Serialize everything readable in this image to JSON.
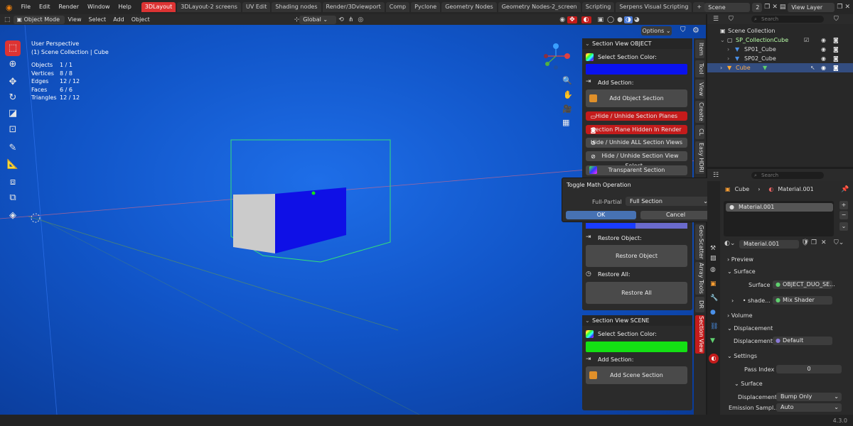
{
  "menubar": {
    "items": [
      "File",
      "Edit",
      "Render",
      "Window",
      "Help"
    ],
    "workspaces": [
      "3DLayout",
      "3DLayout-2 screens",
      "UV Edit",
      "Shading nodes",
      "Render/3Dviewport",
      "Comp",
      "Pyclone",
      "Geometry Nodes",
      "Geometry Nodes-2_screen",
      "Scripting",
      "Serpens Visual Scripting"
    ],
    "active_workspace": "3DLayout",
    "add_tab": "+",
    "scene": "Scene",
    "scene_users": "2",
    "view_layer": "View Layer"
  },
  "viewport_header": {
    "mode": "Object Mode",
    "menus": [
      "View",
      "Select",
      "Add",
      "Object"
    ],
    "orientation": "Global",
    "options": "Options"
  },
  "viewport": {
    "perspective": "User Perspective",
    "collection": "(1) Scene Collection | Cube",
    "stats": [
      {
        "label": "Objects",
        "value": "1 / 1"
      },
      {
        "label": "Vertices",
        "value": "8 / 8"
      },
      {
        "label": "Edges",
        "value": "12 / 12"
      },
      {
        "label": "Faces",
        "value": "6 / 6"
      },
      {
        "label": "Triangles",
        "value": "12 / 12"
      }
    ]
  },
  "section_object": {
    "title": "Section View OBJECT",
    "select_color": "Select Section Color:",
    "color": "#0a12ee",
    "add_section": "Add Section:",
    "add_object_section": "Add Object Section",
    "hide_planes": "Hide / Unhide Section Planes",
    "plane_hidden": "Section Plane Hidden In Render",
    "hide_all": "Hide / Unhide ALL Section Views",
    "hide_selected": "Hide / Unhide Section View Select...",
    "transparent": "Transparent Section",
    "restore_object_label": "Restore Object:",
    "restore_object": "Restore Object",
    "restore_all_label": "Restore All:",
    "restore_all": "Restore All"
  },
  "section_scene": {
    "title": "Section View SCENE",
    "select_color": "Select Section Color:",
    "color": "#14e014",
    "add_section": "Add Section:",
    "add_scene_section": "Add Scene Section"
  },
  "side_tabs": [
    "Item",
    "Tool",
    "View",
    "Create",
    "CL",
    "Easy HDRI",
    "Geo-Scatter",
    "Array Tools",
    "DR",
    "Section View"
  ],
  "popup": {
    "title": "Toggle Math Operation",
    "field_label": "Full-Partial",
    "field_value": "Full Section",
    "ok": "OK",
    "cancel": "Cancel"
  },
  "outliner": {
    "search_placeholder": "Search",
    "rows": [
      {
        "label": "Scene Collection"
      },
      {
        "label": "SP_CollectionCube"
      },
      {
        "label": "SP01_Cube"
      },
      {
        "label": "SP02_Cube"
      },
      {
        "label": "Cube"
      }
    ]
  },
  "properties": {
    "search_placeholder": "Search",
    "breadcrumb_object": "Cube",
    "breadcrumb_material": "Material.001",
    "slot": "Material.001",
    "material_name": "Material.001",
    "preview": "Preview",
    "surface_section": "Surface",
    "surface_label": "Surface",
    "surface_value": "OBJECT_DUO_SE...",
    "shader_label": "shade...",
    "shader_value": "Mix Shader",
    "volume": "Volume",
    "displacement_section": "Displacement",
    "displacement_label": "Displacement",
    "displacement_value": "Default",
    "settings": "Settings",
    "pass_index_label": "Pass Index",
    "pass_index_value": "0",
    "surface_sub": "Surface",
    "disp_method_label": "Displacement",
    "disp_method_value": "Bump Only",
    "emission_label": "Emission Sampl...",
    "emission_value": "Auto"
  },
  "status": {
    "version": "4.3.0"
  }
}
